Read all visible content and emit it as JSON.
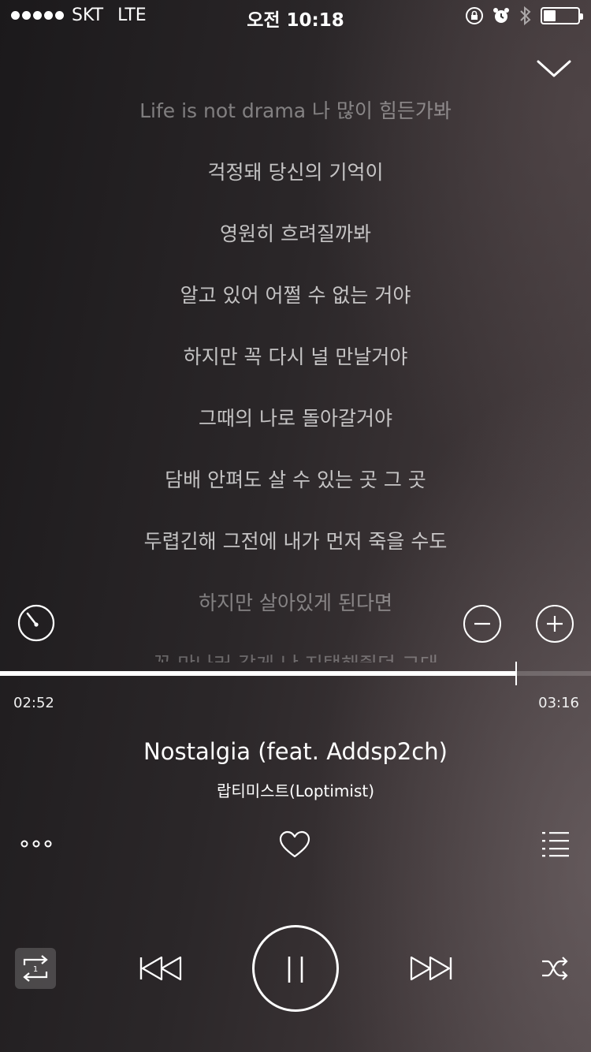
{
  "status_bar": {
    "carrier": "SKT",
    "network": "LTE",
    "time": "오전 10:18",
    "battery_level": 0.35
  },
  "lyrics": [
    "Life is not drama 나 많이 힘든가봐",
    "걱정돼 당신의 기억이",
    "영원히 흐려질까봐",
    "알고 있어 어쩔 수 없는 거야",
    "하지만 꼭 다시 널 만날거야",
    "그때의 나로 돌아갈거야",
    "담배 안펴도 살 수 있는 곳 그 곳",
    "두렵긴해 그전에 내가 먼저 죽을 수도",
    "하지만 살아있게 된다면",
    "꼭 만나러 갈게 난 지탱해줬던 그대"
  ],
  "player": {
    "elapsed": "02:52",
    "duration": "03:16",
    "progress": 0.873,
    "title": "Nostalgia (feat. Addsp2ch)",
    "artist": "랍티미스트(Loptimist)",
    "repeat_badge": "1"
  },
  "icons": {
    "collapse": "chevron-down-icon",
    "timer": "timer-icon",
    "font_decrease": "minus-circle-icon",
    "font_increase": "plus-circle-icon",
    "more": "more-dots-icon",
    "like": "heart-icon",
    "playlist": "playlist-icon",
    "repeat": "repeat-one-icon",
    "previous": "previous-icon",
    "pause": "pause-icon",
    "next": "next-icon",
    "shuffle": "shuffle-icon"
  }
}
